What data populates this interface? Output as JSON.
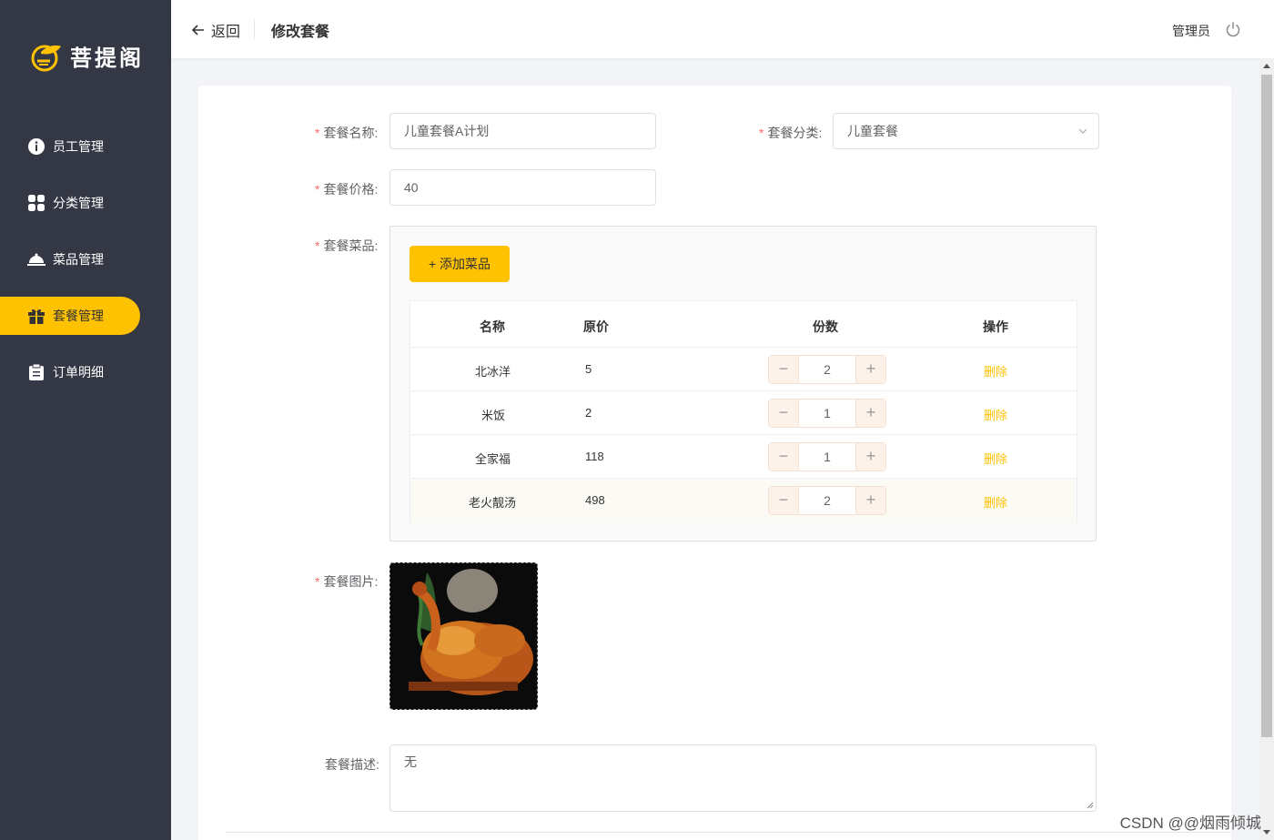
{
  "app": {
    "name": "菩提阁"
  },
  "sidebar": {
    "items": [
      {
        "label": "员工管理",
        "icon": "info-icon",
        "active": false
      },
      {
        "label": "分类管理",
        "icon": "grid-icon",
        "active": false
      },
      {
        "label": "菜品管理",
        "icon": "cloche-icon",
        "active": false
      },
      {
        "label": "套餐管理",
        "icon": "gift-icon",
        "active": true
      },
      {
        "label": "订单明细",
        "icon": "clipboard-icon",
        "active": false
      }
    ]
  },
  "header": {
    "back_label": "返回",
    "title": "修改套餐",
    "user": "管理员"
  },
  "form": {
    "name_label": "套餐名称:",
    "name_value": "儿童套餐A计划",
    "category_label": "套餐分类:",
    "category_value": "儿童套餐",
    "price_label": "套餐价格:",
    "price_value": "40",
    "dishes_label": "套餐菜品:",
    "add_dish_label": "+ 添加菜品",
    "image_label": "套餐图片:",
    "desc_label": "套餐描述:",
    "desc_value": "无",
    "required_mark": "*"
  },
  "table": {
    "headers": {
      "name": "名称",
      "price": "原价",
      "qty": "份数",
      "action": "操作"
    },
    "rows": [
      {
        "name": "北冰洋",
        "price": "5",
        "qty": "2",
        "action": "删除"
      },
      {
        "name": "米饭",
        "price": "2",
        "qty": "1",
        "action": "删除"
      },
      {
        "name": "全家福",
        "price": "118",
        "qty": "1",
        "action": "删除"
      },
      {
        "name": "老火靓汤",
        "price": "498",
        "qty": "2",
        "action": "删除"
      }
    ],
    "minus": "−",
    "plus": "+"
  },
  "watermark": "CSDN @@烟雨倾城",
  "colors": {
    "sidebar_bg": "#343744",
    "accent": "#ffc200",
    "page_bg": "#f3f4f7"
  }
}
